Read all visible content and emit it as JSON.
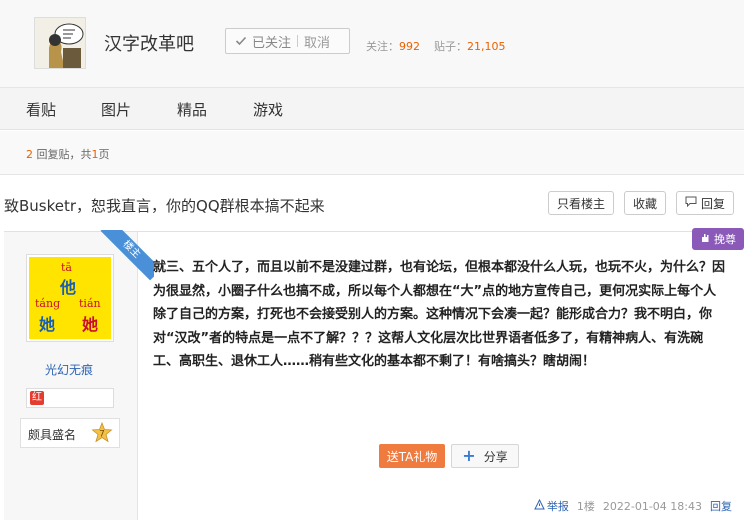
{
  "header": {
    "forum_name": "汉字改革吧",
    "follow_state_label": "已关注",
    "cancel_label": "取消",
    "followers_label": "关注：",
    "followers_count": "992",
    "posts_label": "贴子：",
    "posts_count": "21,105"
  },
  "nav": {
    "tabs": [
      {
        "label": "看贴"
      },
      {
        "label": "图片"
      },
      {
        "label": "精品"
      },
      {
        "label": "游戏"
      }
    ]
  },
  "reply_info": {
    "count": "2",
    "mid": "回复贴，共",
    "pages": "1",
    "suffix": "页"
  },
  "thread": {
    "title": "致Busketr，恕我直言，你的QQ群根本搞不起来",
    "only_op_label": "只看楼主",
    "favorite_label": "收藏",
    "reply_label": "回复"
  },
  "post": {
    "op_flag": "楼主",
    "author": {
      "name": "光幻无痕",
      "level_tag": "红",
      "badge_title": "颇具盛名",
      "level_number": "7",
      "avatar_chars": [
        {
          "pinyin": "tā",
          "char": "他"
        },
        {
          "pinyin": "táng",
          "char": "她"
        },
        {
          "pinyin": "tián",
          "char": "她"
        }
      ]
    },
    "toupiao_label": "挽尊",
    "content": "就三、五个人了，而且以前不是没建过群，也有论坛，但根本都没什么人玩，也玩不火，为什么？因为很显然，小圈子什么也搞不成，所以每个人都想在“大”点的地方宣传自己，更何况实际上每个人除了自己的方案，打死也不会接受别人的方案。这种情况下会凑一起？能形成合力？我不明白，你对“汉改”者的特点是一点不了解？？？这帮人文化层次比世界语者低多了，有精神病人、有洗碗工、高职生、退休工人……稍有些文化的基本都不剩了！有啥搞头？瞎胡闹！",
    "gift_label": "送TA礼物",
    "share_label": "分享",
    "report_label": "举报",
    "floor": "1楼",
    "timestamp": "2022-01-04 18:43",
    "reply_label": "回复"
  },
  "colors": {
    "accent_orange": "#eb6100",
    "link_blue": "#2d64b3",
    "gift_orange": "#f07b3f",
    "op_flag_blue": "#4a90d9",
    "toupiao_purple": "#8b5ab8"
  }
}
